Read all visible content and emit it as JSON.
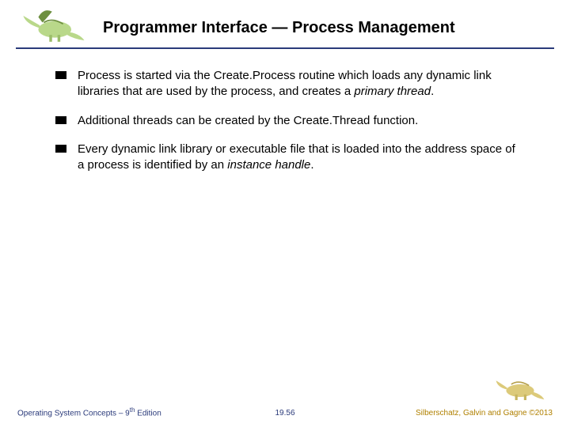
{
  "header": {
    "title": "Programmer Interface — Process Management"
  },
  "bullets": [
    {
      "prefix": "Process is started via the Create.Process routine which loads any dynamic link libraries that are used by the process, and creates a ",
      "italic": "primary thread",
      "suffix": "."
    },
    {
      "prefix": "Additional threads can be created by the Create.Thread function.",
      "italic": "",
      "suffix": ""
    },
    {
      "prefix": "Every dynamic link library or executable file that is loaded into the address space of a process is identified by an ",
      "italic": "instance handle",
      "suffix": "."
    }
  ],
  "footer": {
    "left_a": "Operating System Concepts – 9",
    "left_sup": "th",
    "left_b": " Edition",
    "center": "19.56",
    "right": "Silberschatz, Galvin and Gagne ©2013"
  }
}
